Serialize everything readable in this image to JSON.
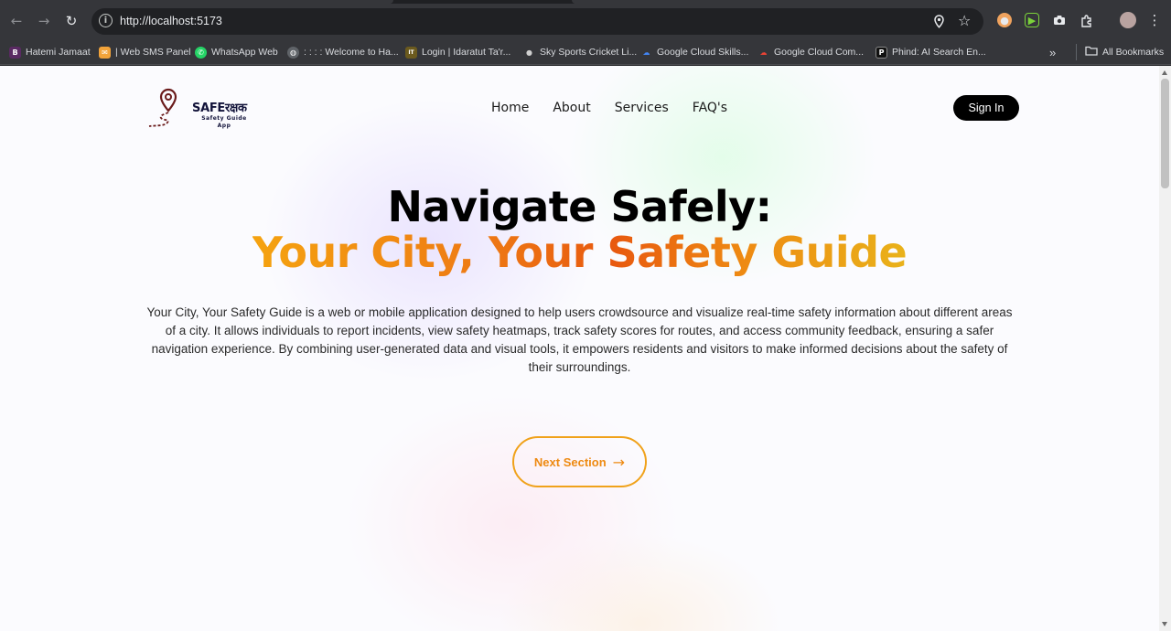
{
  "browser": {
    "url": "http://localhost:5173",
    "bookmarks": [
      {
        "label": "Hatemi Jamaat",
        "icon": "b-icon",
        "color": "#5a2a63"
      },
      {
        "label": "| Web SMS Panel",
        "icon": "sms-icon",
        "color": "#f2a33a"
      },
      {
        "label": "WhatsApp Web",
        "icon": "whatsapp-icon",
        "color": "#25d366"
      },
      {
        "label": ": : : : Welcome to Ha...",
        "icon": "globe-icon",
        "color": "#8a8c90"
      },
      {
        "label": "Login | Idaratut Ta'r...",
        "icon": "idara-icon",
        "color": "#6b5a1e"
      },
      {
        "label": "Sky Sports Cricket Li...",
        "icon": "cricket-icon",
        "color": "#cfcfcf"
      },
      {
        "label": "Google Cloud Skills...",
        "icon": "google-cloud-icon",
        "color": "#4285f4"
      },
      {
        "label": "Google Cloud Com...",
        "icon": "google-cloud-icon",
        "color": "#4285f4"
      },
      {
        "label": "Phind: AI Search En...",
        "icon": "phind-icon",
        "color": "#111111"
      }
    ],
    "all_bookmarks_label": "All Bookmarks",
    "overflow_label": "»"
  },
  "site": {
    "logo": {
      "title": "SAFEरक्षक",
      "subtitle_line1": "Safety Guide",
      "subtitle_line2": "App"
    },
    "nav": [
      "Home",
      "About",
      "Services",
      "FAQ's"
    ],
    "signin_label": "Sign In"
  },
  "hero": {
    "title": "Navigate Safely:",
    "subtitle": "Your City, Your Safety Guide",
    "description": "Your City, Your Safety Guide is a web or mobile application designed to help users crowdsource and visualize real-time safety information about different areas of a city. It allows individuals to report incidents, view safety heatmaps, track safety scores for routes, and access community feedback, ensuring a safer navigation experience. By combining user-generated data and visual tools, it empowers residents and visitors to make informed decisions about the safety of their surroundings.",
    "button_label": "Next Section",
    "button_arrow": "→"
  },
  "colors": {
    "accent_orange": "#ee8a12",
    "signin_bg": "#000000",
    "chrome_bg": "#35363a"
  }
}
